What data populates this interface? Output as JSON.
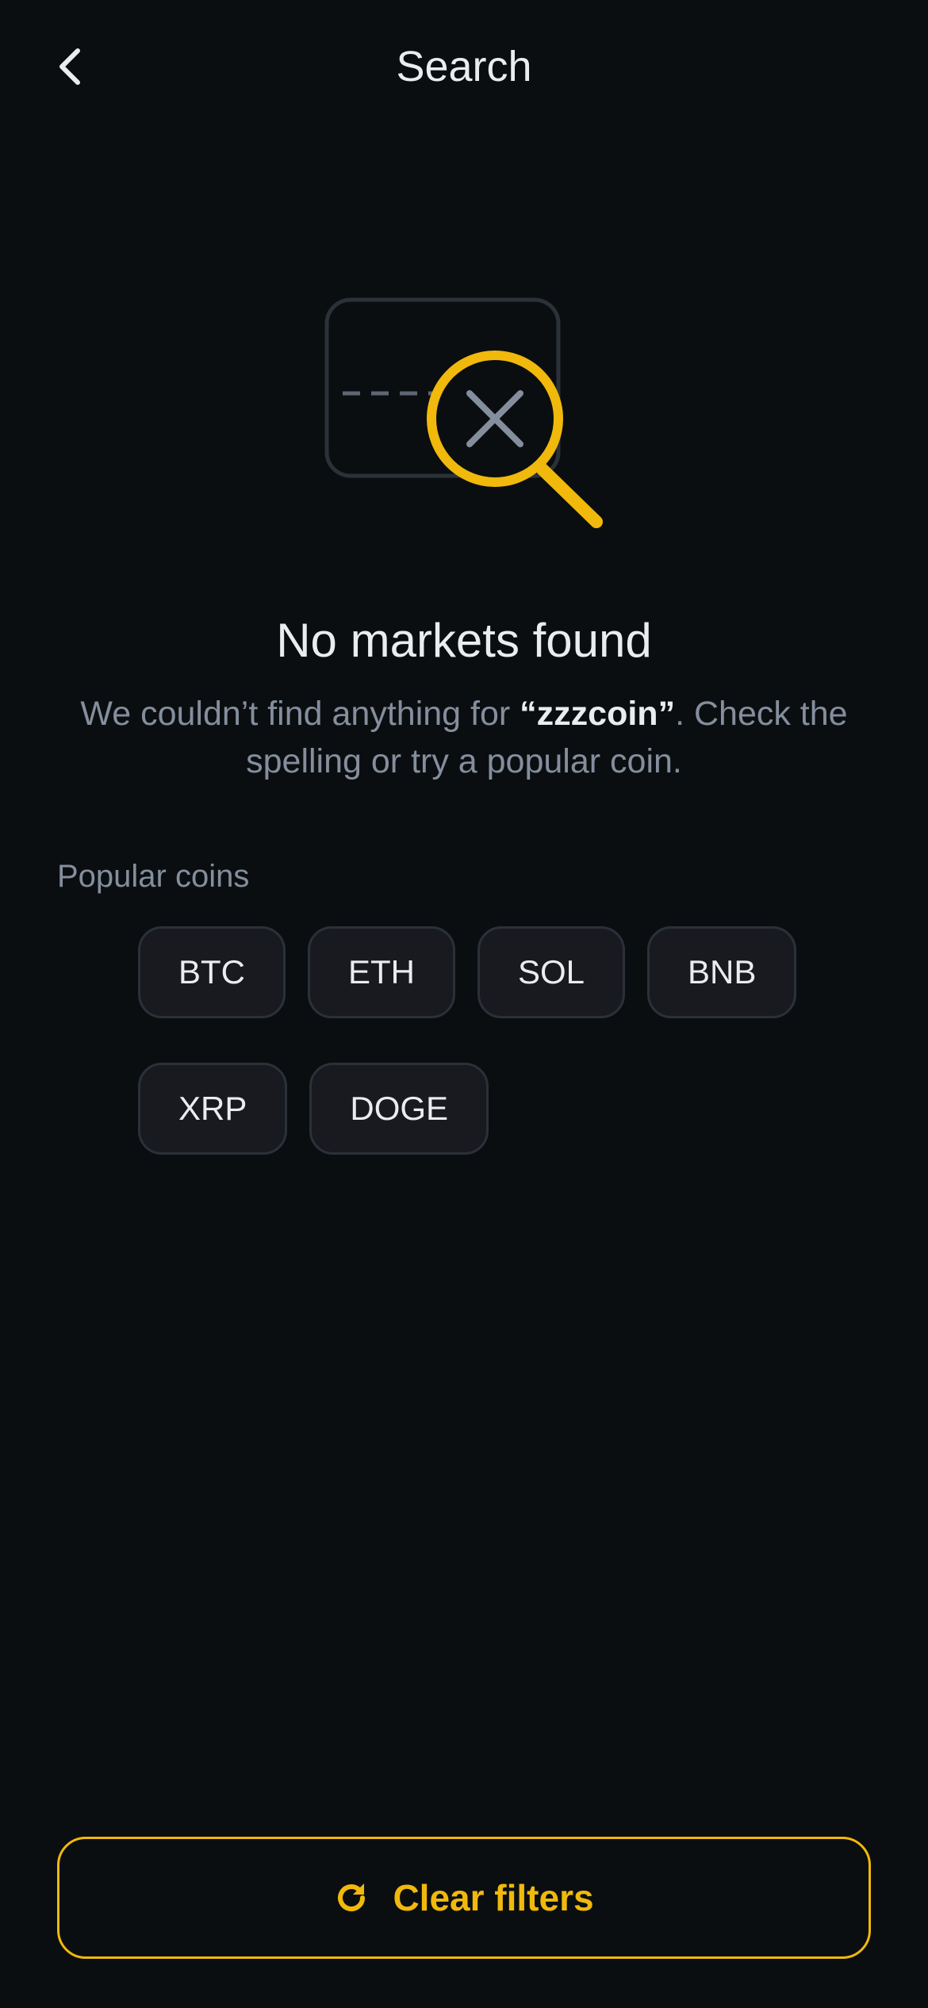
{
  "header": {
    "title": "Search",
    "back_icon": "chevron-left-icon"
  },
  "empty_state": {
    "illustration_icon": "search-no-results-icon",
    "title": "No markets found",
    "desc_before": "We couldn’t find anything for ",
    "query": "“zzzcoin”",
    "desc_after": ". Check the spelling or try a popular coin."
  },
  "popular": {
    "label": "Popular coins",
    "coins_row1": [
      "BTC",
      "ETH",
      "SOL",
      "BNB"
    ],
    "coins_row2": [
      "XRP",
      "DOGE"
    ]
  },
  "footer": {
    "clear_label": "Clear filters",
    "clear_icon": "refresh-icon"
  },
  "colors": {
    "background": "#0b0e11",
    "accent": "#f0b90b",
    "muted_text": "#848e9c",
    "chip_bg": "#181a20",
    "chip_border": "#2b3139"
  }
}
